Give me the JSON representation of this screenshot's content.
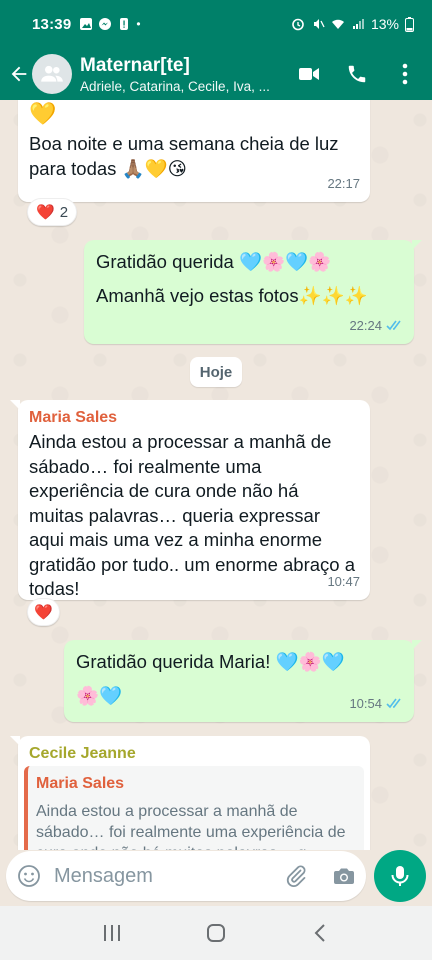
{
  "status_bar": {
    "time": "13:39",
    "battery": "13%",
    "dot": "•"
  },
  "header": {
    "group_name": "Maternar[te]",
    "members": "Adriele, Catarina, Cecile, Iva, ..."
  },
  "messages": [
    {
      "id": "m1",
      "direction": "incoming",
      "text_top": "💛",
      "text": "Boa noite e uma semana cheia de luz para todas 🙏🏽💛😘",
      "time": "22:17",
      "reaction": {
        "emoji": "❤️",
        "count": "2"
      }
    },
    {
      "id": "m2",
      "direction": "outgoing",
      "line1": "Gratidão querida 🩵🌸🩵🌸",
      "line2": "Amanhã vejo estas fotos✨✨✨",
      "time": "22:24",
      "status": "read"
    },
    {
      "id": "m3",
      "direction": "incoming",
      "sender": "Maria Sales",
      "sender_color": "#e0613d",
      "text": "Ainda estou a processar a manhã de sábado… foi realmente uma experiência de cura onde não há muitas palavras… queria expressar aqui mais uma vez a minha enorme gratidão por tudo.. um enorme abraço a todas!",
      "time": "10:47",
      "reaction": {
        "emoji": "❤️"
      }
    },
    {
      "id": "m4",
      "direction": "outgoing",
      "line1": "Gratidão querida Maria! 🩵🌸🩵",
      "line2": "🌸🩵",
      "time": "10:54",
      "status": "read"
    },
    {
      "id": "m5",
      "direction": "incoming",
      "sender": "Cecile Jeanne",
      "sender_color": "#a5a72c",
      "quote": {
        "author": "Maria Sales",
        "text": "Ainda estou a processar a manhã de sábado… foi realmente uma experiência de cura onde não há muitas palavras… q"
      }
    }
  ],
  "day_separator": "Hoje",
  "composer": {
    "placeholder": "Mensagem"
  },
  "colors": {
    "primary": "#008069",
    "mic": "#00a884",
    "incoming_bubble": "#ffffff",
    "outgoing_bubble": "#d9fdd3",
    "read_ticks": "#53bdeb"
  },
  "icons": [
    "back-arrow-icon",
    "group-avatar-icon",
    "video-call-icon",
    "phone-icon",
    "more-vert-icon",
    "emoji-icon",
    "attach-icon",
    "camera-icon",
    "mic-icon",
    "recent-apps-icon",
    "home-icon",
    "back-nav-icon"
  ]
}
